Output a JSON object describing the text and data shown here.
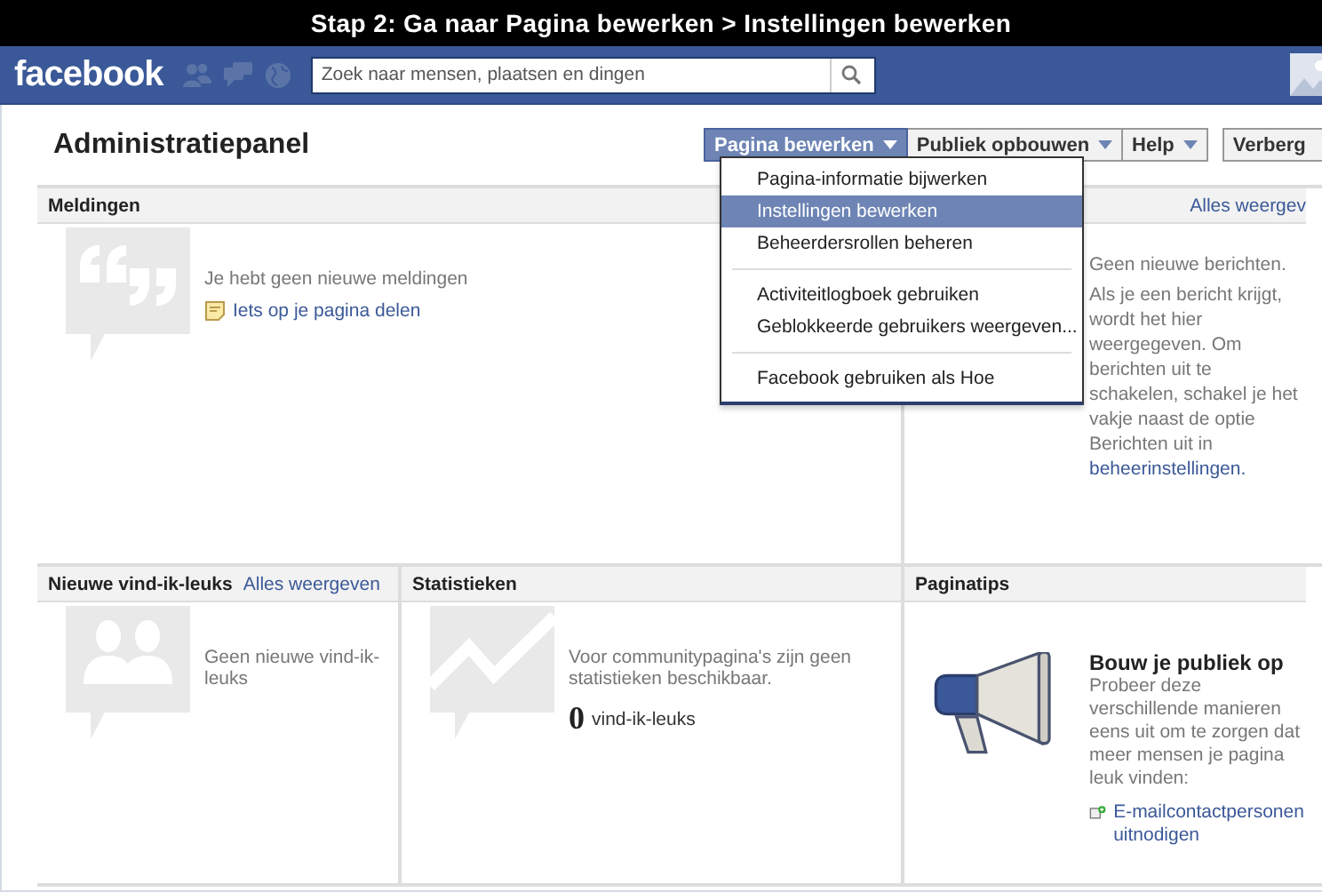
{
  "banner": {
    "title": "Stap 2: Ga naar Pagina bewerken > Instellingen bewerken"
  },
  "topbar": {
    "logo": "facebook",
    "search": {
      "placeholder": "Zoek naar mensen, plaatsen en dingen"
    }
  },
  "page_title": "Administratiepanel",
  "toolbar": [
    {
      "label": "Pagina bewerken",
      "selected": true,
      "dropdown": true
    },
    {
      "label": "Publiek opbouwen",
      "selected": false,
      "dropdown": true
    },
    {
      "label": "Help",
      "selected": false,
      "dropdown": true
    },
    {
      "label": "Verberg",
      "selected": false,
      "dropdown": false
    }
  ],
  "menu": [
    {
      "kind": "item",
      "label": "Pagina-informatie bijwerken",
      "selected": false
    },
    {
      "kind": "item",
      "label": "Instellingen bewerken",
      "selected": true
    },
    {
      "kind": "item",
      "label": "Beheerdersrollen beheren",
      "selected": false
    },
    {
      "kind": "separator"
    },
    {
      "kind": "item",
      "label": "Activiteitlogboek gebruiken",
      "selected": false
    },
    {
      "kind": "item",
      "label": "Geblokkeerde gebruikers weergeven...",
      "selected": false
    },
    {
      "kind": "separator"
    },
    {
      "kind": "item",
      "label": "Facebook gebruiken als Hoe",
      "selected": false
    }
  ],
  "notifications": {
    "title": "Meldingen",
    "text": "Je hebt geen nieuwe meldingen",
    "link": "Iets op je pagina delen"
  },
  "messages": {
    "link": "Alles weergev",
    "title": "Geen nieuwe berichten.",
    "text": "Als je een bericht krijgt, wordt het hier weergegeven. Om berichten uit te schakelen, schakel je het vakje naast de optie Berichten uit in",
    "settings_link": "beheerinstellingen."
  },
  "likes": {
    "title": "Nieuwe vind-ik-leuks",
    "link": "Alles weergeven",
    "text": "Geen nieuwe vind-ik-leuks"
  },
  "stats": {
    "title": "Statistieken",
    "text": "Voor communitypagina's zijn geen statistieken beschikbaar.",
    "count": "0",
    "count_label": "vind-ik-leuks"
  },
  "tips": {
    "title": "Paginatips",
    "heading": "Bouw je publiek op",
    "text": "Probeer deze verschillende manieren eens uit om te zorgen dat meer mensen je pagina leuk vinden:",
    "link": "E-mailcontactpersonen uitnodigen"
  }
}
